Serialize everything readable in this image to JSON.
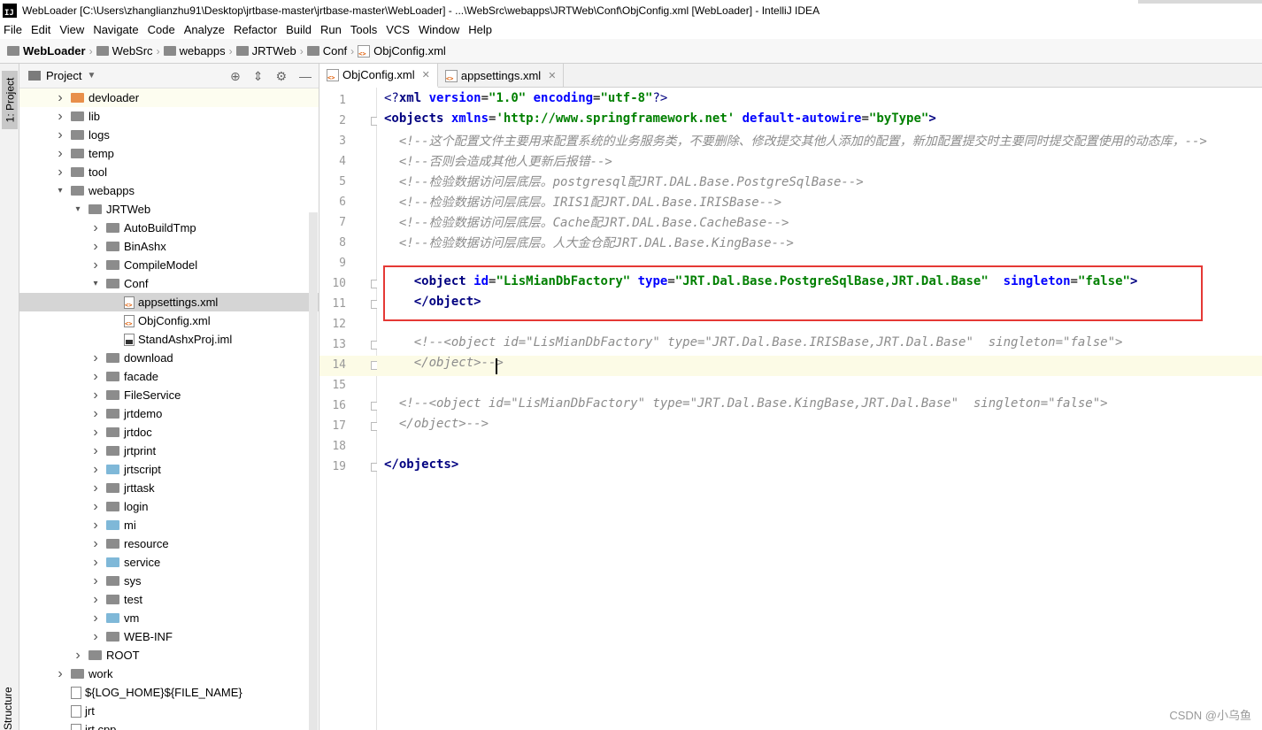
{
  "window": {
    "title": "WebLoader [C:\\Users\\zhanglianzhu91\\Desktop\\jrtbase-master\\jrtbase-master\\WebLoader] - ...\\WebSrc\\webapps\\JRTWeb\\Conf\\ObjConfig.xml [WebLoader] - IntelliJ IDEA",
    "app_icon": "IJ"
  },
  "menu": [
    "File",
    "Edit",
    "View",
    "Navigate",
    "Code",
    "Analyze",
    "Refactor",
    "Build",
    "Run",
    "Tools",
    "VCS",
    "Window",
    "Help"
  ],
  "breadcrumb": [
    "WebLoader",
    "WebSrc",
    "webapps",
    "JRTWeb",
    "Conf",
    "ObjConfig.xml"
  ],
  "sidebar": {
    "project_tab": "1: Project",
    "structure_tab": "Structure"
  },
  "project_panel": {
    "title": "Project",
    "tree": [
      {
        "label": "devloader",
        "indent": 0,
        "arrow": "right",
        "icon": "folder-orange",
        "highlight": true
      },
      {
        "label": "lib",
        "indent": 0,
        "arrow": "right",
        "icon": "folder"
      },
      {
        "label": "logs",
        "indent": 0,
        "arrow": "right",
        "icon": "folder"
      },
      {
        "label": "temp",
        "indent": 0,
        "arrow": "right",
        "icon": "folder"
      },
      {
        "label": "tool",
        "indent": 0,
        "arrow": "right",
        "icon": "folder"
      },
      {
        "label": "webapps",
        "indent": 0,
        "arrow": "down",
        "icon": "folder"
      },
      {
        "label": "JRTWeb",
        "indent": 1,
        "arrow": "down",
        "icon": "folder"
      },
      {
        "label": "AutoBuildTmp",
        "indent": 2,
        "arrow": "right",
        "icon": "folder"
      },
      {
        "label": "BinAshx",
        "indent": 2,
        "arrow": "right",
        "icon": "folder"
      },
      {
        "label": "CompileModel",
        "indent": 2,
        "arrow": "right",
        "icon": "folder"
      },
      {
        "label": "Conf",
        "indent": 2,
        "arrow": "down",
        "icon": "folder"
      },
      {
        "label": "appsettings.xml",
        "indent": 3,
        "arrow": "none",
        "icon": "file-xml",
        "selected": true
      },
      {
        "label": "ObjConfig.xml",
        "indent": 3,
        "arrow": "none",
        "icon": "file-xml"
      },
      {
        "label": "StandAshxProj.iml",
        "indent": 3,
        "arrow": "none",
        "icon": "file-iml"
      },
      {
        "label": "download",
        "indent": 2,
        "arrow": "right",
        "icon": "folder"
      },
      {
        "label": "facade",
        "indent": 2,
        "arrow": "right",
        "icon": "folder"
      },
      {
        "label": "FileService",
        "indent": 2,
        "arrow": "right",
        "icon": "folder"
      },
      {
        "label": "jrtdemo",
        "indent": 2,
        "arrow": "right",
        "icon": "folder"
      },
      {
        "label": "jrtdoc",
        "indent": 2,
        "arrow": "right",
        "icon": "folder"
      },
      {
        "label": "jrtprint",
        "indent": 2,
        "arrow": "right",
        "icon": "folder"
      },
      {
        "label": "jrtscript",
        "indent": 2,
        "arrow": "right",
        "icon": "folder-blue"
      },
      {
        "label": "jrttask",
        "indent": 2,
        "arrow": "right",
        "icon": "folder"
      },
      {
        "label": "login",
        "indent": 2,
        "arrow": "right",
        "icon": "folder"
      },
      {
        "label": "mi",
        "indent": 2,
        "arrow": "right",
        "icon": "folder-blue"
      },
      {
        "label": "resource",
        "indent": 2,
        "arrow": "right",
        "icon": "folder"
      },
      {
        "label": "service",
        "indent": 2,
        "arrow": "right",
        "icon": "folder-blue"
      },
      {
        "label": "sys",
        "indent": 2,
        "arrow": "right",
        "icon": "folder"
      },
      {
        "label": "test",
        "indent": 2,
        "arrow": "right",
        "icon": "folder"
      },
      {
        "label": "vm",
        "indent": 2,
        "arrow": "right",
        "icon": "folder-blue"
      },
      {
        "label": "WEB-INF",
        "indent": 2,
        "arrow": "right",
        "icon": "folder"
      },
      {
        "label": "ROOT",
        "indent": 1,
        "arrow": "right",
        "icon": "folder"
      },
      {
        "label": "work",
        "indent": 0,
        "arrow": "right",
        "icon": "folder"
      },
      {
        "label": "${LOG_HOME}${FILE_NAME}",
        "indent": 0,
        "arrow": "none",
        "icon": "file-plain"
      },
      {
        "label": "jrt",
        "indent": 0,
        "arrow": "none",
        "icon": "file-plain"
      },
      {
        "label": "jrt.cpp",
        "indent": 0,
        "arrow": "none",
        "icon": "file-plain"
      }
    ]
  },
  "tabs": [
    {
      "label": "ObjConfig.xml",
      "active": true
    },
    {
      "label": "appsettings.xml",
      "active": false
    }
  ],
  "editor": {
    "current_line": 14,
    "lines": [
      [
        [
          "pi",
          "<?"
        ],
        [
          "tag",
          "xml "
        ],
        [
          "attr",
          "version"
        ],
        [
          "",
          "="
        ],
        [
          "val",
          "\"1.0\""
        ],
        [
          "attr",
          " encoding"
        ],
        [
          "",
          "="
        ],
        [
          "val",
          "\"utf-8\""
        ],
        [
          "pi",
          "?>"
        ]
      ],
      [
        [
          "tag",
          "<objects "
        ],
        [
          "attr",
          "xmlns"
        ],
        [
          "",
          "="
        ],
        [
          "val",
          "'http://www.springframework.net'"
        ],
        [
          "attr",
          " default-autowire"
        ],
        [
          "",
          "="
        ],
        [
          "val",
          "\"byType\""
        ],
        [
          "tag",
          ">"
        ]
      ],
      [
        [
          "cm",
          "  <!--这个配置文件主要用来配置系统的业务服务类，不要删除、修改提交其他人添加的配置，新加配置提交时主要同时提交配置使用的动态库，-->"
        ]
      ],
      [
        [
          "cm",
          "  <!--否则会造成其他人更新后报错-->"
        ]
      ],
      [
        [
          "cm",
          "  <!--检验数据访问层底层。postgresql配JRT.DAL.Base.PostgreSqlBase-->"
        ]
      ],
      [
        [
          "cm",
          "  <!--检验数据访问层底层。IRIS1配JRT.DAL.Base.IRISBase-->"
        ]
      ],
      [
        [
          "cm",
          "  <!--检验数据访问层底层。Cache配JRT.DAL.Base.CacheBase-->"
        ]
      ],
      [
        [
          "cm",
          "  <!--检验数据访问层底层。人大金仓配JRT.DAL.Base.KingBase-->"
        ]
      ],
      [],
      [
        [
          "",
          "    "
        ],
        [
          "tag",
          "<object "
        ],
        [
          "attr",
          "id"
        ],
        [
          "",
          "="
        ],
        [
          "val",
          "\"LisMianDbFactory\""
        ],
        [
          "attr",
          " type"
        ],
        [
          "",
          "="
        ],
        [
          "val",
          "\"JRT.Dal.Base.PostgreSqlBase,JRT.Dal.Base\""
        ],
        [
          "attr",
          "  singleton"
        ],
        [
          "",
          "="
        ],
        [
          "val",
          "\"false\""
        ],
        [
          "tag",
          ">"
        ]
      ],
      [
        [
          "",
          "    "
        ],
        [
          "tag",
          "</object>"
        ]
      ],
      [],
      [
        [
          "cm",
          "    <!--<object id=\"LisMianDbFactory\" type=\"JRT.Dal.Base.IRISBase,JRT.Dal.Base\"  singleton=\"false\">"
        ]
      ],
      [
        [
          "cm",
          "    </object>-->"
        ]
      ],
      [],
      [
        [
          "cm",
          "  <!--<object id=\"LisMianDbFactory\" type=\"JRT.Dal.Base.KingBase,JRT.Dal.Base\"  singleton=\"false\">"
        ]
      ],
      [
        [
          "cm",
          "  </object>-->"
        ]
      ],
      [],
      [
        [
          "tag",
          "</objects>"
        ]
      ]
    ]
  },
  "watermark": "CSDN @小乌鱼"
}
